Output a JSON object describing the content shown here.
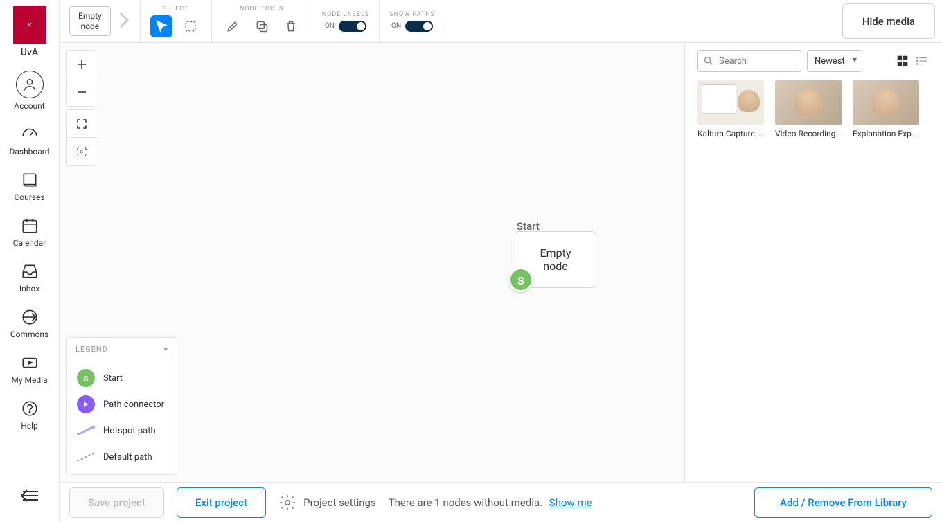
{
  "brand": {
    "short": "UvA"
  },
  "sidebar": {
    "items": [
      {
        "label": "Account"
      },
      {
        "label": "Dashboard"
      },
      {
        "label": "Courses"
      },
      {
        "label": "Calendar"
      },
      {
        "label": "Inbox"
      },
      {
        "label": "Commons"
      },
      {
        "label": "My Media"
      },
      {
        "label": "Help"
      }
    ]
  },
  "breadcrumb": {
    "node_line1": "Empty",
    "node_line2": "node"
  },
  "toolbar": {
    "select_label": "SELECT",
    "node_tools_label": "NODE TOOLS",
    "node_labels_label": "NODE LABELS",
    "show_paths_label": "SHOW PATHS",
    "node_labels_state": "ON",
    "show_paths_state": "ON",
    "hide_media": "Hide media"
  },
  "canvas": {
    "node_tag": "Start",
    "node_text_l1": "Empty",
    "node_text_l2": "node",
    "node_badge": "s"
  },
  "legend": {
    "title": "LEGEND",
    "items": [
      {
        "label": "Start"
      },
      {
        "label": "Path connector"
      },
      {
        "label": "Hotspot path"
      },
      {
        "label": "Default path"
      }
    ]
  },
  "media": {
    "search_placeholder": "Search",
    "sort": "Newest",
    "items": [
      {
        "title": "Kaltura Capture r…"
      },
      {
        "title": "Video Recording …"
      },
      {
        "title": "Explanation Expr…"
      }
    ]
  },
  "bottom": {
    "save": "Save project",
    "exit": "Exit project",
    "settings": "Project settings",
    "status": "There are 1 nodes without media.",
    "show_me": "Show me",
    "library": "Add / Remove From Library"
  }
}
